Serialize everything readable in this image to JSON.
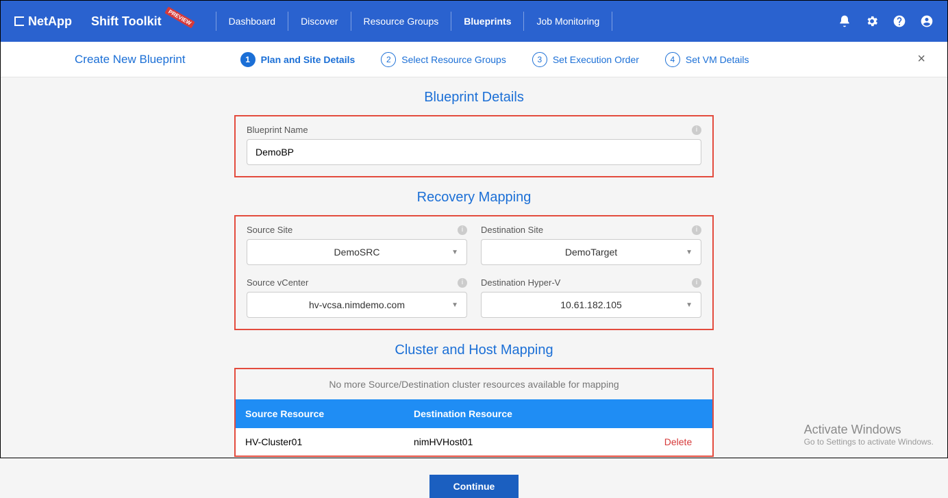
{
  "brand": "NetApp",
  "app": "Shift Toolkit",
  "preview_badge": "PREVIEW",
  "nav": {
    "dashboard": "Dashboard",
    "discover": "Discover",
    "resource_groups": "Resource Groups",
    "blueprints": "Blueprints",
    "job_monitoring": "Job Monitoring"
  },
  "wizard_title": "Create New Blueprint",
  "steps": {
    "s1": {
      "num": "1",
      "label": "Plan and Site Details"
    },
    "s2": {
      "num": "2",
      "label": "Select Resource Groups"
    },
    "s3": {
      "num": "3",
      "label": "Set Execution Order"
    },
    "s4": {
      "num": "4",
      "label": "Set VM Details"
    }
  },
  "sections": {
    "details": "Blueprint Details",
    "recovery": "Recovery Mapping",
    "cluster": "Cluster and Host Mapping"
  },
  "form": {
    "bp_name_label": "Blueprint Name",
    "bp_name_value": "DemoBP",
    "source_site_label": "Source Site",
    "source_site_value": "DemoSRC",
    "dest_site_label": "Destination Site",
    "dest_site_value": "DemoTarget",
    "source_vcenter_label": "Source vCenter",
    "source_vcenter_value": "hv-vcsa.nimdemo.com",
    "dest_hyperv_label": "Destination Hyper-V",
    "dest_hyperv_value": "10.61.182.105"
  },
  "cluster": {
    "nomore": "No more Source/Destination cluster resources available for mapping",
    "col_src": "Source Resource",
    "col_dst": "Destination Resource",
    "row_src": "HV-Cluster01",
    "row_dst": "nimHVHost01",
    "delete": "Delete"
  },
  "continue": "Continue",
  "watermark": {
    "l1": "Activate Windows",
    "l2": "Go to Settings to activate Windows."
  }
}
